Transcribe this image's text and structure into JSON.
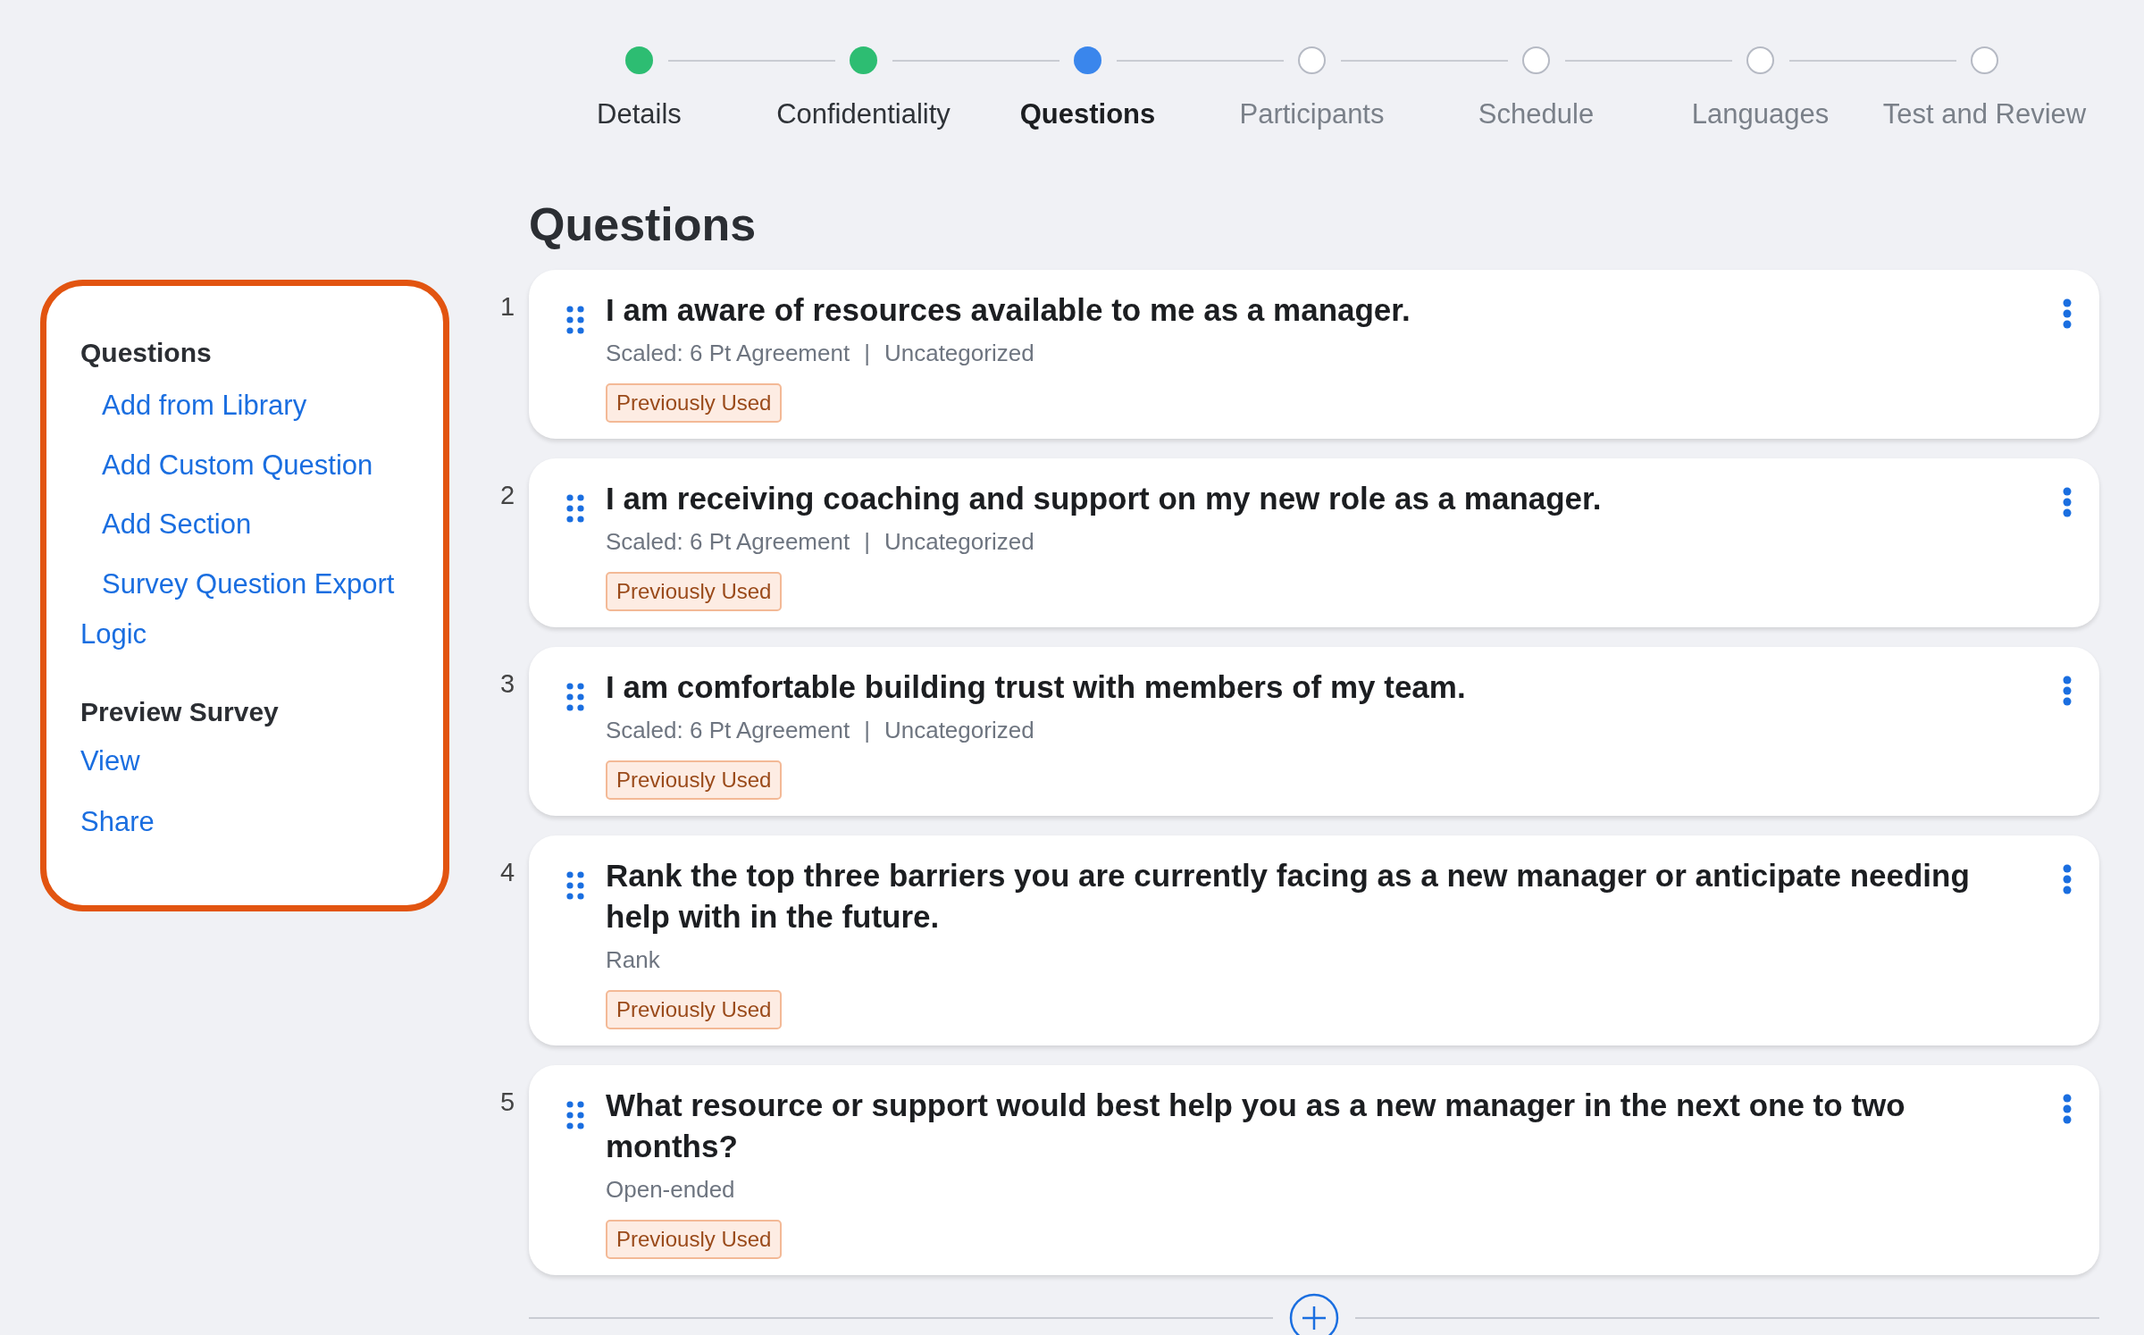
{
  "stepper": [
    {
      "label": "Details",
      "completed": true,
      "selected": false
    },
    {
      "label": "Confidentiality",
      "completed": true,
      "selected": false
    },
    {
      "label": "Questions",
      "completed": false,
      "selected": true
    },
    {
      "label": "Participants",
      "completed": false,
      "selected": false
    },
    {
      "label": "Schedule",
      "completed": false,
      "selected": false
    },
    {
      "label": "Languages",
      "completed": false,
      "selected": false
    },
    {
      "label": "Test and Review",
      "completed": false,
      "selected": false
    }
  ],
  "sidebar": {
    "items": [
      {
        "label": "Questions",
        "kind": "heading",
        "children": [
          {
            "label": "Add from Library",
            "kind": "link"
          },
          {
            "label": "Add Custom Question",
            "kind": "link"
          },
          {
            "label": "Add Section",
            "kind": "link"
          },
          {
            "label": "Survey Question Export",
            "kind": "link"
          }
        ]
      },
      {
        "label": "Logic",
        "kind": "link"
      },
      {
        "label": "Preview Survey",
        "kind": "heading"
      },
      {
        "label": "View",
        "kind": "link"
      },
      {
        "label": "Share",
        "kind": "link"
      }
    ]
  },
  "heading": "Questions",
  "questions": [
    {
      "number": "1",
      "text": "I am aware of resources available to me as a manager.",
      "type": "Scaled: 6 Pt Agreement",
      "separator": "|",
      "category": "Uncategorized",
      "badge": "Previously Used"
    },
    {
      "number": "2",
      "text": "I am receiving coaching and support on my new role as a manager.",
      "type": "Scaled: 6 Pt Agreement",
      "separator": "|",
      "category": "Uncategorized",
      "badge": "Previously Used"
    },
    {
      "number": "3",
      "text": "I am comfortable building trust with members of my team.",
      "type": "Scaled: 6 Pt Agreement",
      "separator": "|",
      "category": "Uncategorized",
      "badge": "Previously Used"
    },
    {
      "number": "4",
      "text": "Rank the top three barriers you are currently facing as a new manager or anticipate needing help with in the future.",
      "type": "Rank",
      "badge": "Previously Used"
    },
    {
      "number": "5",
      "text": "What resource or support would best help you as a new manager in the next one to two months?",
      "type": "Open-ended",
      "badge": "Previously Used"
    }
  ]
}
